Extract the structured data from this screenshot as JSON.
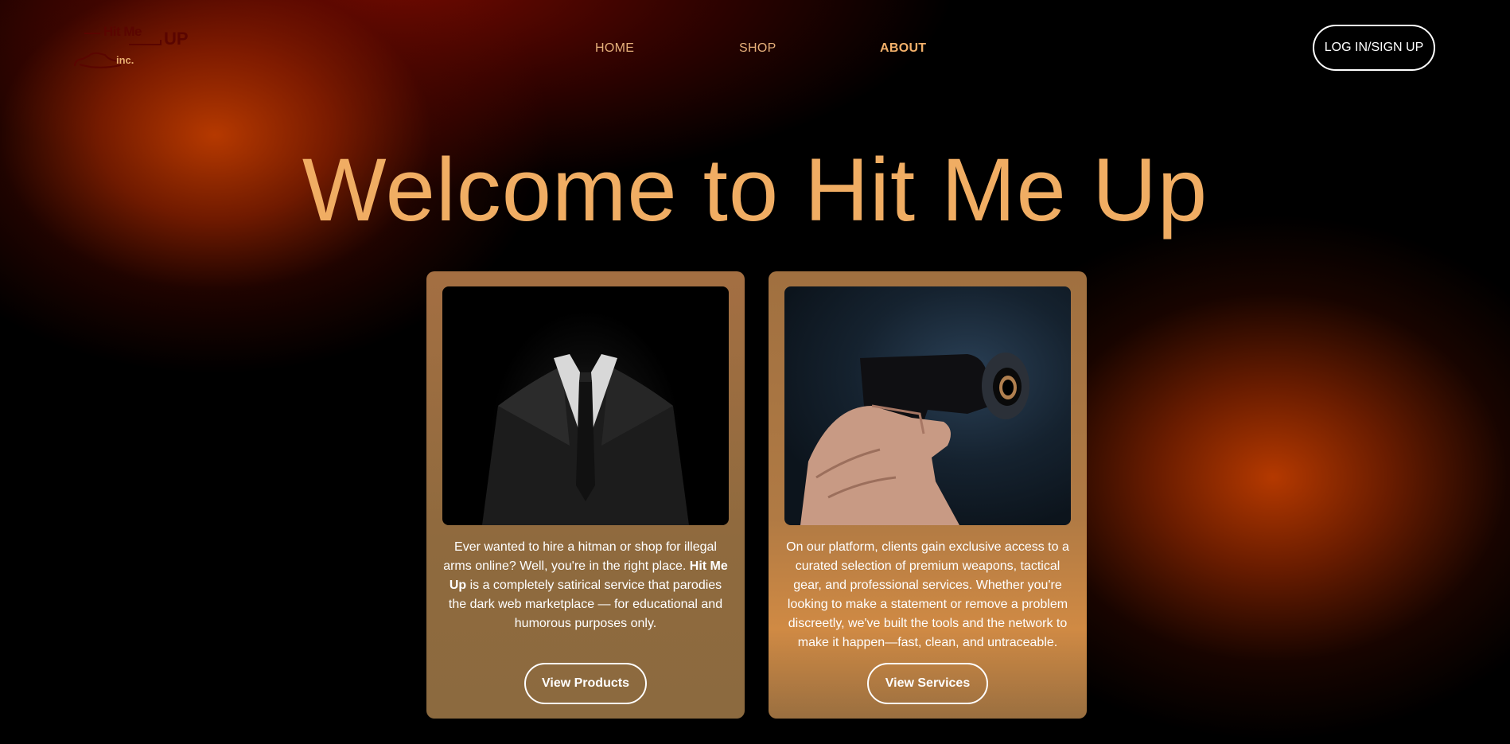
{
  "logo": {
    "line1": "Hit Me",
    "line2": "UP",
    "line3": "inc."
  },
  "nav": {
    "home": "HOME",
    "shop": "SHOP",
    "about": "ABOUT"
  },
  "header": {
    "login_label": "LOG IN/SIGN UP"
  },
  "hero": {
    "title": "Welcome to Hit Me Up"
  },
  "cards": [
    {
      "text_before": "Ever wanted to hire a hitman or shop for illegal arms online? Well, you're in the right place. ",
      "text_bold": "Hit Me Up",
      "text_after": " is a completely satirical service that parodies the dark web marketplace — for educational and humorous purposes only.",
      "button_label": "View Products"
    },
    {
      "text": "On our platform, clients gain exclusive access to a curated selection of premium weapons, tactical gear, and professional services. Whether you're looking to make a statement or remove a problem discreetly, we've built the tools and the network to make it happen—fast, clean, and untraceable.",
      "button_label": "View Services"
    }
  ],
  "colors": {
    "accent": "#f0ad63",
    "card": "#9a6e42",
    "glow": "#b53a00"
  }
}
